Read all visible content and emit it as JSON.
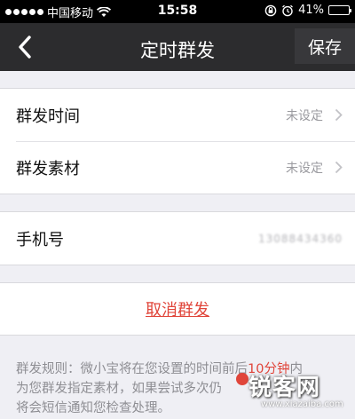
{
  "status_bar": {
    "carrier": "中国移动",
    "time": "15:58",
    "battery": "41%",
    "battery_level": 0.41,
    "icons": [
      "signal-dots-icon",
      "wifi-icon",
      "rotation-lock-icon",
      "alarm-icon",
      "battery-icon"
    ]
  },
  "nav": {
    "title": "定时群发",
    "save_label": "保存"
  },
  "settings": {
    "items": [
      {
        "label": "群发时间",
        "value": "未设定"
      },
      {
        "label": "群发素材",
        "value": "未设定"
      }
    ]
  },
  "phone": {
    "label": "手机号",
    "value": "13088434360"
  },
  "cancel": {
    "label": "取消群发"
  },
  "rules": {
    "line1_before": "群发规则：微小宝将在您设置的时间前后",
    "line1_highlight": "10分钟",
    "line1_after": "内",
    "line2": "为您群发指定素材，如果尝试多次仍",
    "line3": "将会短信通知您检查处理。"
  },
  "watermark": {
    "text": "锐客网",
    "url": "www.xiazaiba.com"
  },
  "colors": {
    "nav_bg": "#2c2c2e",
    "accent_red": "#e0453a",
    "page_bg": "#efeff4"
  }
}
